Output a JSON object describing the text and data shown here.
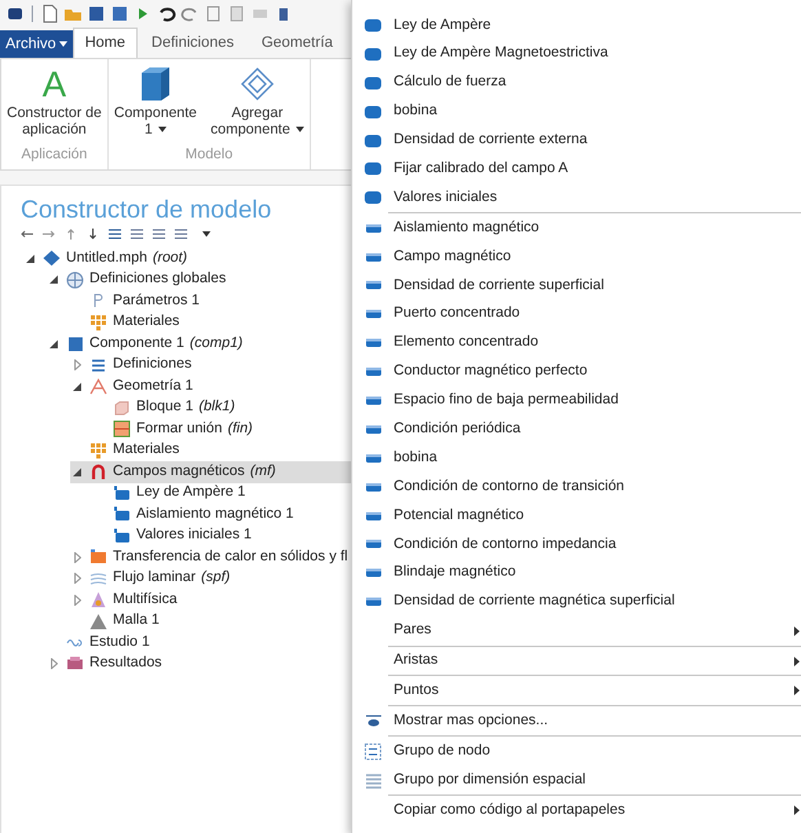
{
  "ribbon": {
    "file_menu": "Archivo",
    "tabs": [
      {
        "label": "Home",
        "selected": true
      },
      {
        "label": "Definiciones",
        "selected": false
      },
      {
        "label": "Geometría",
        "selected": false
      }
    ],
    "groups": [
      {
        "label": "Aplicación",
        "buttons": [
          {
            "kind": "letter",
            "glyph": "A",
            "lines": [
              "Constructor de",
              "aplicación"
            ],
            "dropdown": false
          }
        ]
      },
      {
        "label": "Modelo",
        "buttons": [
          {
            "kind": "cube",
            "lines": [
              "Componente",
              "1"
            ],
            "dropdown": true
          },
          {
            "kind": "wire",
            "lines": [
              "Agregar",
              "componente"
            ],
            "dropdown": true
          }
        ]
      }
    ]
  },
  "builder": {
    "title": "Constructor de modelo",
    "tree": [
      {
        "kind": "root",
        "label": "Untitled.mph",
        "tag": "(root)",
        "expanded": true,
        "selected": false,
        "children": [
          {
            "kind": "globe",
            "label": "Definiciones globales",
            "expanded": true,
            "selected": false,
            "children": [
              {
                "kind": "param",
                "label": "Parámetros 1",
                "selected": false
              },
              {
                "kind": "material",
                "label": "Materiales",
                "selected": false
              }
            ]
          },
          {
            "kind": "component",
            "label": "Componente 1",
            "tag": "(comp1)",
            "expanded": true,
            "selected": false,
            "children": [
              {
                "kind": "list",
                "label": "Definiciones",
                "expanded": false,
                "selected": false
              },
              {
                "kind": "geometry",
                "label": "Geometría 1",
                "expanded": true,
                "selected": false,
                "children": [
                  {
                    "kind": "block",
                    "label": "Bloque 1",
                    "tag": "(blk1)",
                    "selected": false
                  },
                  {
                    "kind": "union",
                    "label": "Formar unión",
                    "tag": "(fin)",
                    "selected": false
                  }
                ]
              },
              {
                "kind": "material",
                "label": "Materiales",
                "selected": false
              },
              {
                "kind": "magnet",
                "label": "Campos magnéticos",
                "tag": "(mf)",
                "expanded": true,
                "selected": true,
                "children": [
                  {
                    "kind": "feature",
                    "label": "Ley de Ampère 1",
                    "selected": false
                  },
                  {
                    "kind": "feature",
                    "label": "Aislamiento magnético 1",
                    "selected": false
                  },
                  {
                    "kind": "feature",
                    "label": "Valores iniciales 1",
                    "selected": false
                  }
                ]
              },
              {
                "kind": "heat",
                "label": "Transferencia de calor en sólidos y fl",
                "expanded": false,
                "selected": false
              },
              {
                "kind": "flow",
                "label": "Flujo laminar",
                "tag": "(spf)",
                "expanded": false,
                "selected": false
              },
              {
                "kind": "multiphysics",
                "label": "Multifísica",
                "expanded": false,
                "selected": false
              },
              {
                "kind": "mesh",
                "label": "Malla 1",
                "selected": false
              }
            ]
          },
          {
            "kind": "study",
            "label": "Estudio 1",
            "selected": false
          },
          {
            "kind": "results",
            "label": "Resultados",
            "expanded": false,
            "selected": false
          }
        ]
      }
    ]
  },
  "context_menu": {
    "sections": [
      [
        {
          "kind": "domain",
          "label": "Ley de Ampère"
        },
        {
          "kind": "domain",
          "label": "Ley de Ampère Magnetoestrictiva"
        },
        {
          "kind": "domain",
          "label": "Cálculo de fuerza"
        },
        {
          "kind": "domain",
          "label": "bobina"
        },
        {
          "kind": "domain",
          "label": "Densidad de corriente externa"
        },
        {
          "kind": "domain",
          "label": "Fijar calibrado del campo A"
        },
        {
          "kind": "domain",
          "label": "Valores iniciales"
        }
      ],
      [
        {
          "kind": "boundary",
          "label": "Aislamiento magnético"
        },
        {
          "kind": "boundary",
          "label": "Campo magnético"
        },
        {
          "kind": "boundary",
          "label": "Densidad de corriente superficial"
        },
        {
          "kind": "boundary",
          "label": "Puerto concentrado"
        },
        {
          "kind": "boundary",
          "label": "Elemento concentrado"
        },
        {
          "kind": "boundary",
          "label": "Conductor magnético perfecto"
        },
        {
          "kind": "boundary",
          "label": "Espacio fino de baja permeabilidad"
        },
        {
          "kind": "boundary",
          "label": "Condición periódica"
        },
        {
          "kind": "boundary",
          "label": "bobina"
        },
        {
          "kind": "boundary",
          "label": "Condición de contorno de transición"
        },
        {
          "kind": "boundary",
          "label": "Potencial magnético"
        },
        {
          "kind": "boundary",
          "label": "Condición de contorno impedancia"
        },
        {
          "kind": "boundary",
          "label": "Blindaje magnético"
        },
        {
          "kind": "boundary",
          "label": "Densidad de corriente magnética superficial"
        },
        {
          "kind": "submenu",
          "label": "Pares"
        }
      ],
      [
        {
          "kind": "submenu",
          "label": "Aristas"
        }
      ],
      [
        {
          "kind": "submenu",
          "label": "Puntos"
        }
      ],
      [
        {
          "kind": "show",
          "label": "Mostrar mas opciones..."
        }
      ],
      [
        {
          "kind": "group",
          "label": "Grupo de nodo"
        },
        {
          "kind": "dimension",
          "label": "Grupo por dimensión espacial"
        }
      ],
      [
        {
          "kind": "submenu",
          "label": "Copiar como código al portapapeles"
        }
      ]
    ]
  }
}
